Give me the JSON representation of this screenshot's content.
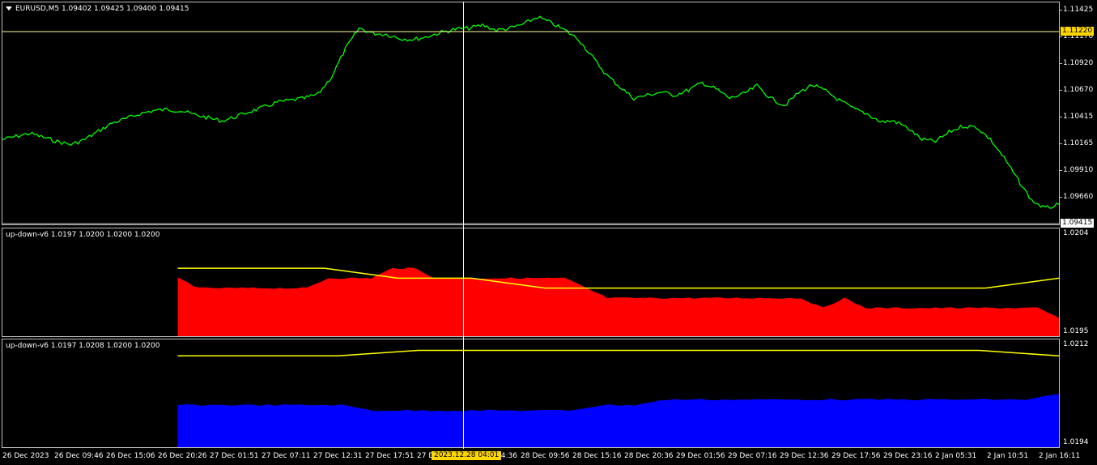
{
  "main_chart": {
    "title": "EURUSD,M5  1.09402 1.09425 1.09400 1.09415",
    "price_scale": [
      "1.11425",
      "1.11170",
      "1.10920",
      "1.10670",
      "1.10415",
      "1.10165",
      "1.09910",
      "1.09660"
    ],
    "crosshair_price": "1.11220",
    "current_price": "1.09415",
    "line_color": "#00ff00",
    "price_range": [
      1.0938,
      1.1155
    ],
    "close_series": [
      1.1022,
      1.1025,
      1.1028,
      1.1024,
      1.102,
      1.1017,
      1.1022,
      1.103,
      1.1038,
      1.1042,
      1.1047,
      1.105,
      1.1051,
      1.105,
      1.1046,
      1.1043,
      1.104,
      1.1044,
      1.1049,
      1.1053,
      1.1058,
      1.106,
      1.1062,
      1.1066,
      1.1083,
      1.111,
      1.113,
      1.1125,
      1.1124,
      1.112,
      1.1119,
      1.1122,
      1.1126,
      1.1129,
      1.113,
      1.1133,
      1.1128,
      1.113,
      1.1134,
      1.1141,
      1.1135,
      1.1128,
      1.1119,
      1.1102,
      1.1085,
      1.1073,
      1.1062,
      1.1065,
      1.1068,
      1.1065,
      1.107,
      1.1077,
      1.1071,
      1.1062,
      1.1066,
      1.1074,
      1.1062,
      1.1055,
      1.1067,
      1.1075,
      1.1069,
      1.106,
      1.1052,
      1.1047,
      1.1039,
      1.104,
      1.1033,
      1.1022,
      1.102,
      1.1029,
      1.1035,
      1.1034,
      1.1022,
      1.1004,
      1.0983,
      1.0963,
      1.0955,
      1.0959
    ]
  },
  "indicator1": {
    "title": "up-down-v6 1.0197 1.0200 1.0200 1.0200",
    "scale": [
      "1.0204",
      "1.0195"
    ],
    "fill_color": "#ff0000",
    "line_color": "#ffff00",
    "range": [
      1.0194,
      1.0205
    ],
    "start_fraction": 0.166,
    "fill_series": [
      1.02,
      1.0199,
      1.0199,
      1.0199,
      1.0199,
      1.0199,
      1.0199,
      1.02,
      1.02,
      1.02,
      1.0201,
      1.0201,
      1.02,
      1.02,
      1.02,
      1.02,
      1.02,
      1.02,
      1.02,
      1.0199,
      1.0198,
      1.0198,
      1.0198,
      1.0198,
      1.0198,
      1.0198,
      1.0198,
      1.0198,
      1.0198,
      1.0198,
      1.0197,
      1.0198,
      1.0197,
      1.0197,
      1.0197,
      1.0197,
      1.0197,
      1.0197,
      1.0197,
      1.0197,
      1.0197,
      1.0196
    ],
    "line_series": [
      1.0201,
      1.0201,
      1.0201,
      1.02,
      1.02,
      1.0199,
      1.0199,
      1.0199,
      1.0199,
      1.0199,
      1.0199,
      1.0199,
      1.02
    ]
  },
  "indicator2": {
    "title": "up-down-v6 1.0197 1.0208 1.0200 1.0200",
    "scale": [
      "1.0212",
      "1.0194"
    ],
    "fill_color": "#0000ff",
    "line_color": "#ffff00",
    "range": [
      1.0193,
      1.0213
    ],
    "start_fraction": 0.166,
    "fill_series": [
      1.0201,
      1.0201,
      1.0201,
      1.0201,
      1.0201,
      1.0201,
      1.02,
      1.02,
      1.02,
      1.02,
      1.02,
      1.02,
      1.02,
      1.0201,
      1.0201,
      1.0202,
      1.0202,
      1.0202,
      1.0202,
      1.0202,
      1.0202,
      1.0202,
      1.0202,
      1.0202,
      1.0202,
      1.0202,
      1.0202,
      1.0203
    ],
    "line_series": [
      1.021,
      1.021,
      1.021,
      1.0211,
      1.0211,
      1.0211,
      1.0211,
      1.0211,
      1.0211,
      1.0211,
      1.0211,
      1.021
    ]
  },
  "time_axis": [
    "26 Dec 2023",
    "26 Dec 09:46",
    "26 Dec 15:06",
    "26 Dec 20:26",
    "27 Dec 01:51",
    "27 Dec 07:11",
    "27 Dec 12:31",
    "27 Dec 17:51",
    "27 D",
    "04:36",
    "28 Dec 09:56",
    "28 Dec 15:16",
    "28 Dec 20:36",
    "29 Dec 01:56",
    "29 Dec 07:16",
    "29 Dec 12:36",
    "29 Dec 17:56",
    "29 Dec 23:16",
    "2 Jan 05:31",
    "2 Jan 10:51",
    "2 Jan 16:11"
  ],
  "crosshair_time": "2023.12.28 04:01",
  "crosshair_color": "#ffff99"
}
